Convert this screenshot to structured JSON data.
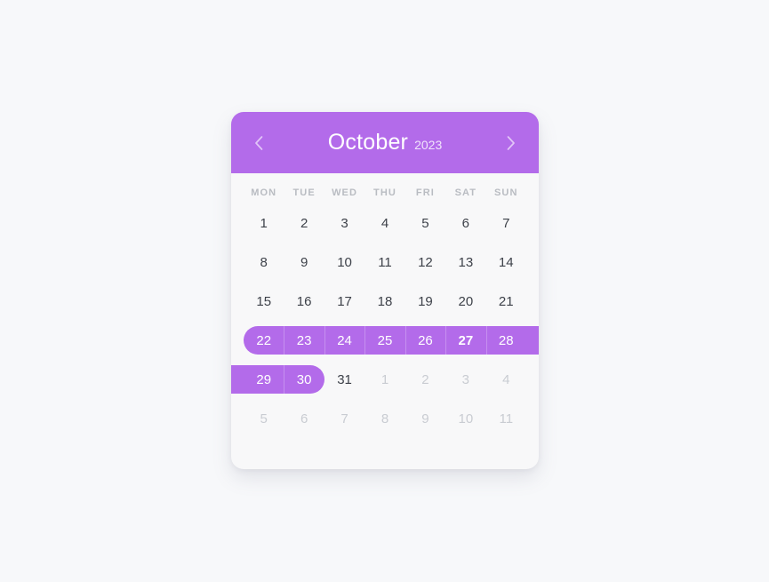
{
  "header": {
    "month": "October",
    "year": "2023",
    "prev_icon": "chevron-left-icon",
    "next_icon": "chevron-right-icon",
    "background_color": "#b36bea"
  },
  "weekdays": [
    "MON",
    "TUE",
    "WED",
    "THU",
    "FRI",
    "SAT",
    "SUN"
  ],
  "weeks": [
    [
      {
        "label": "1",
        "muted": false,
        "in_range": false,
        "today": false
      },
      {
        "label": "2",
        "muted": false,
        "in_range": false,
        "today": false
      },
      {
        "label": "3",
        "muted": false,
        "in_range": false,
        "today": false
      },
      {
        "label": "4",
        "muted": false,
        "in_range": false,
        "today": false
      },
      {
        "label": "5",
        "muted": false,
        "in_range": false,
        "today": false
      },
      {
        "label": "6",
        "muted": false,
        "in_range": false,
        "today": false
      },
      {
        "label": "7",
        "muted": false,
        "in_range": false,
        "today": false
      }
    ],
    [
      {
        "label": "8",
        "muted": false,
        "in_range": false,
        "today": false
      },
      {
        "label": "9",
        "muted": false,
        "in_range": false,
        "today": false
      },
      {
        "label": "10",
        "muted": false,
        "in_range": false,
        "today": false
      },
      {
        "label": "11",
        "muted": false,
        "in_range": false,
        "today": false
      },
      {
        "label": "12",
        "muted": false,
        "in_range": false,
        "today": false
      },
      {
        "label": "13",
        "muted": false,
        "in_range": false,
        "today": false
      },
      {
        "label": "14",
        "muted": false,
        "in_range": false,
        "today": false
      }
    ],
    [
      {
        "label": "15",
        "muted": false,
        "in_range": false,
        "today": false
      },
      {
        "label": "16",
        "muted": false,
        "in_range": false,
        "today": false
      },
      {
        "label": "17",
        "muted": false,
        "in_range": false,
        "today": false
      },
      {
        "label": "18",
        "muted": false,
        "in_range": false,
        "today": false
      },
      {
        "label": "19",
        "muted": false,
        "in_range": false,
        "today": false
      },
      {
        "label": "20",
        "muted": false,
        "in_range": false,
        "today": false
      },
      {
        "label": "21",
        "muted": false,
        "in_range": false,
        "today": false
      }
    ],
    [
      {
        "label": "22",
        "muted": false,
        "in_range": true,
        "today": false
      },
      {
        "label": "23",
        "muted": false,
        "in_range": true,
        "today": false
      },
      {
        "label": "24",
        "muted": false,
        "in_range": true,
        "today": false
      },
      {
        "label": "25",
        "muted": false,
        "in_range": true,
        "today": false
      },
      {
        "label": "26",
        "muted": false,
        "in_range": true,
        "today": false
      },
      {
        "label": "27",
        "muted": false,
        "in_range": true,
        "today": true
      },
      {
        "label": "28",
        "muted": false,
        "in_range": true,
        "today": false
      }
    ],
    [
      {
        "label": "29",
        "muted": false,
        "in_range": true,
        "today": false
      },
      {
        "label": "30",
        "muted": false,
        "in_range": true,
        "today": false
      },
      {
        "label": "31",
        "muted": false,
        "in_range": false,
        "today": false
      },
      {
        "label": "1",
        "muted": true,
        "in_range": false,
        "today": false
      },
      {
        "label": "2",
        "muted": true,
        "in_range": false,
        "today": false
      },
      {
        "label": "3",
        "muted": true,
        "in_range": false,
        "today": false
      },
      {
        "label": "4",
        "muted": true,
        "in_range": false,
        "today": false
      }
    ],
    [
      {
        "label": "5",
        "muted": true,
        "in_range": false,
        "today": false
      },
      {
        "label": "6",
        "muted": true,
        "in_range": false,
        "today": false
      },
      {
        "label": "7",
        "muted": true,
        "in_range": false,
        "today": false
      },
      {
        "label": "8",
        "muted": true,
        "in_range": false,
        "today": false
      },
      {
        "label": "9",
        "muted": true,
        "in_range": false,
        "today": false
      },
      {
        "label": "10",
        "muted": true,
        "in_range": false,
        "today": false
      },
      {
        "label": "11",
        "muted": true,
        "in_range": false,
        "today": false
      }
    ]
  ],
  "selection": {
    "start": "22",
    "end": "30",
    "today": "27",
    "highlight_color": "#b36bea"
  }
}
